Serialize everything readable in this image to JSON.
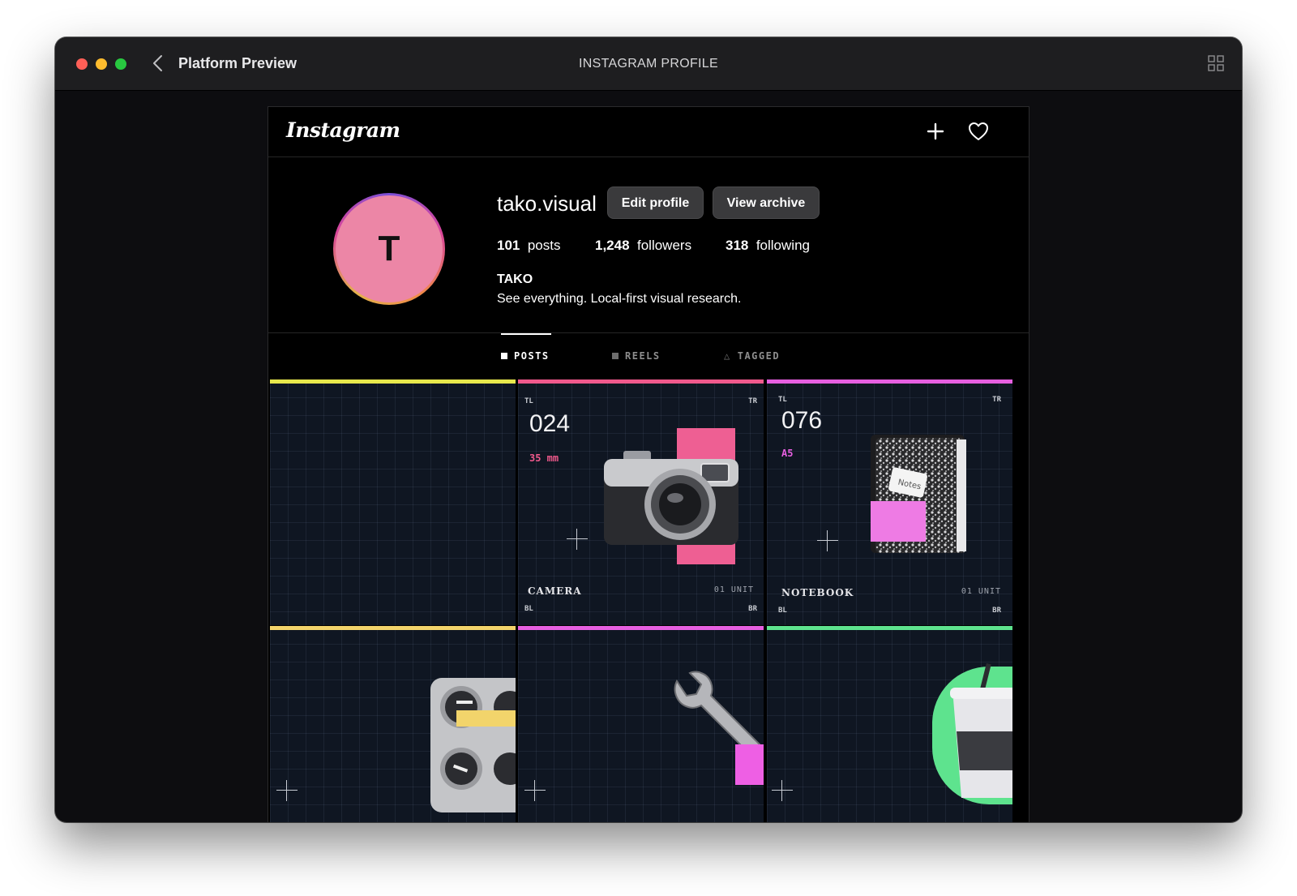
{
  "window": {
    "app_title": "Platform Preview",
    "title": "INSTAGRAM PROFILE",
    "icons": {
      "back": "chevron-left-icon",
      "grid": "grid-view-icon"
    }
  },
  "instagram": {
    "logo": "Instagram",
    "header_icons": [
      "plus-icon",
      "heart-icon"
    ],
    "profile": {
      "avatar_letter": "T",
      "username": "tako.visual",
      "edit_label": "Edit profile",
      "archive_label": "View archive",
      "stats": [
        {
          "count": "101",
          "label": "posts"
        },
        {
          "count": "1,248",
          "label": "followers"
        },
        {
          "count": "318",
          "label": "following"
        }
      ],
      "display_name": "TAKO",
      "bio": "See everything. Local-first visual research."
    },
    "tabs": [
      {
        "label": "POSTS",
        "active": true
      },
      {
        "label": "REELS",
        "active": false
      },
      {
        "label": "TAGGED",
        "active": false
      }
    ],
    "posts": [
      {
        "accent": "#e8e84c"
      },
      {
        "accent": "#f0598c",
        "tl": "TL",
        "tr": "TR",
        "bl": "BL",
        "br": "BR",
        "number": "024",
        "sub": "35 mm",
        "sub_color": "#f0598c",
        "caption": "CAMERA",
        "unit": "01 UNIT"
      },
      {
        "accent": "#e65fe0",
        "tl": "TL",
        "tr": "TR",
        "bl": "BL",
        "br": "BR",
        "number": "076",
        "sub": "A5",
        "sub_color": "#e65fe0",
        "caption": "NOTEBOOK",
        "unit": "01 UNIT"
      },
      {
        "accent": "#f2d46b"
      },
      {
        "accent": "#e65fe0"
      },
      {
        "accent": "#5ee38e"
      }
    ],
    "notebook_label": "Notes"
  }
}
